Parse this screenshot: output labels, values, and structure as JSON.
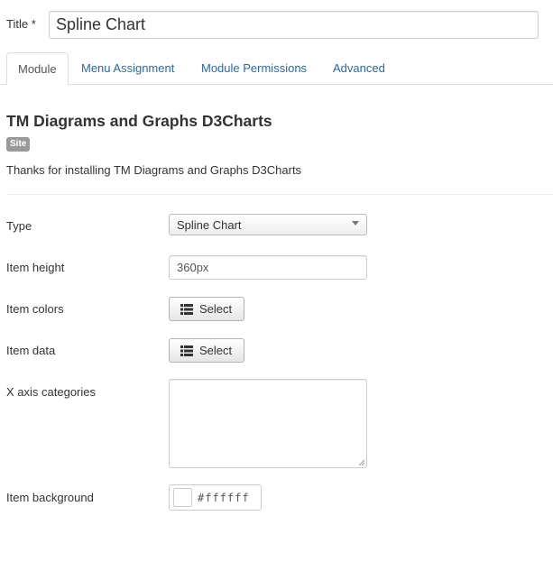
{
  "form": {
    "title_label": "Title *",
    "title_value": "Spline Chart"
  },
  "tabs": [
    {
      "label": "Module",
      "active": true
    },
    {
      "label": "Menu Assignment",
      "active": false
    },
    {
      "label": "Module Permissions",
      "active": false
    },
    {
      "label": "Advanced",
      "active": false
    }
  ],
  "module": {
    "heading": "TM Diagrams and Graphs D3Charts",
    "badge": "Site",
    "description": "Thanks for installing TM Diagrams and Graphs D3Charts"
  },
  "fields": {
    "type_label": "Type",
    "type_value": "Spline Chart",
    "height_label": "Item height",
    "height_value": "360px",
    "colors_label": "Item colors",
    "colors_button": "Select",
    "data_label": "Item data",
    "data_button": "Select",
    "xaxis_label": "X axis categories",
    "xaxis_value": "",
    "background_label": "Item background",
    "background_value": "#ffffff"
  },
  "icons": {
    "select_button_icon": "list-icon",
    "type_dropdown_icon": "caret-down-icon",
    "textarea_resize_icon": "resize-grip-icon"
  },
  "colors": {
    "link": "#2a69a2",
    "badge": "#999999",
    "background_swatch": "#ffffff"
  }
}
